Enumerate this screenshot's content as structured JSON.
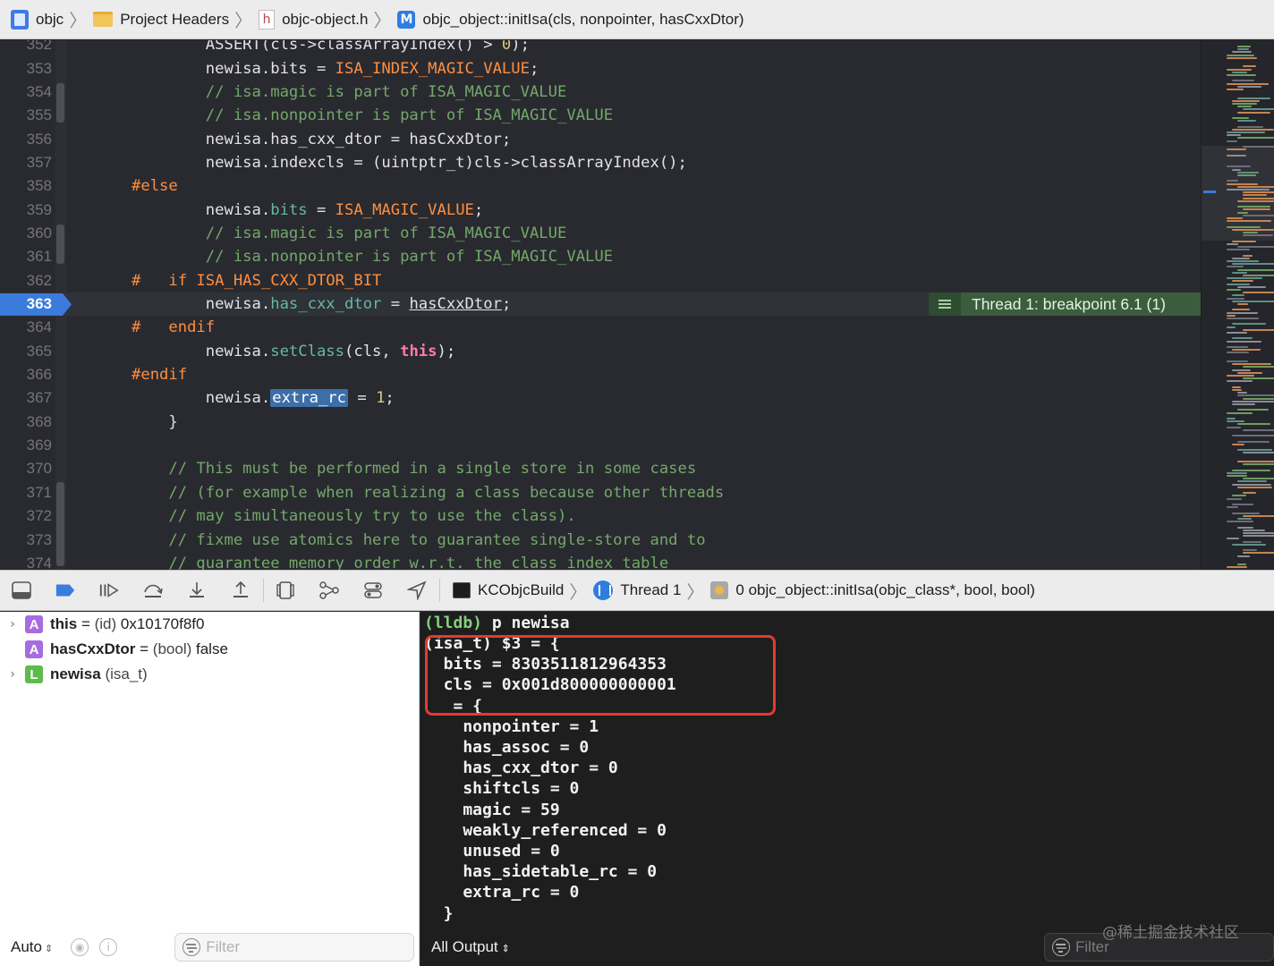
{
  "breadcrumb": {
    "items": [
      {
        "label": "objc",
        "icon": "project-icon"
      },
      {
        "label": "Project Headers",
        "icon": "folder-icon"
      },
      {
        "label": "objc-object.h",
        "icon": "header-file-icon",
        "icon_glyph": "h"
      },
      {
        "label": "objc_object::initIsa(cls, nonpointer, hasCxxDtor)",
        "icon": "method-icon",
        "icon_glyph": "M"
      }
    ]
  },
  "editor": {
    "current_line": "363",
    "breakpoint_banner": "Thread 1: breakpoint 6.1 (1)",
    "lines": [
      {
        "no": "352",
        "text": "        ASSERT(cls->classArrayIndex() > 0);"
      },
      {
        "no": "353",
        "text": "        newisa.bits = ISA_INDEX_MAGIC_VALUE;"
      },
      {
        "no": "354",
        "text": "        // isa.magic is part of ISA_MAGIC_VALUE"
      },
      {
        "no": "355",
        "text": "        // isa.nonpointer is part of ISA_MAGIC_VALUE"
      },
      {
        "no": "356",
        "text": "        newisa.has_cxx_dtor = hasCxxDtor;"
      },
      {
        "no": "357",
        "text": "        newisa.indexcls = (uintptr_t)cls->classArrayIndex();"
      },
      {
        "no": "358",
        "text": "#else"
      },
      {
        "no": "359",
        "text": "        newisa.bits = ISA_MAGIC_VALUE;"
      },
      {
        "no": "360",
        "text": "        // isa.magic is part of ISA_MAGIC_VALUE"
      },
      {
        "no": "361",
        "text": "        // isa.nonpointer is part of ISA_MAGIC_VALUE"
      },
      {
        "no": "362",
        "text": "#   if ISA_HAS_CXX_DTOR_BIT"
      },
      {
        "no": "363",
        "text": "        newisa.has_cxx_dtor = hasCxxDtor;"
      },
      {
        "no": "364",
        "text": "#   endif"
      },
      {
        "no": "365",
        "text": "        newisa.setClass(cls, this);"
      },
      {
        "no": "366",
        "text": "#endif"
      },
      {
        "no": "367",
        "text": "        newisa.extra_rc = 1;"
      },
      {
        "no": "368",
        "text": "    }"
      },
      {
        "no": "369",
        "text": ""
      },
      {
        "no": "370",
        "text": "    // This must be performed in a single store in some cases"
      },
      {
        "no": "371",
        "text": "    // (for example when realizing a class because other threads"
      },
      {
        "no": "372",
        "text": "    // may simultaneously try to use the class)."
      },
      {
        "no": "373",
        "text": "    // fixme use atomics here to guarantee single-store and to"
      },
      {
        "no": "374",
        "text": "    // guarantee memory order w.r.t. the class index table"
      }
    ]
  },
  "debug_bar": {
    "process": "KCObjcBuild",
    "thread": "Thread 1",
    "frame": "0 objc_object::initIsa(objc_class*, bool, bool)"
  },
  "variables": {
    "items": [
      {
        "badge": "A",
        "name": "this",
        "eq": " = ",
        "type": "(id)",
        "value": " 0x10170f8f0",
        "expandable": true
      },
      {
        "badge": "A",
        "name": "hasCxxDtor",
        "eq": " = ",
        "type": "(bool)",
        "value": " false",
        "expandable": false
      },
      {
        "badge": "L",
        "name": "newisa",
        "eq": " ",
        "type": "(isa_t)",
        "value": "",
        "expandable": true
      }
    ],
    "scope": "Auto",
    "filter_placeholder": "Filter"
  },
  "console": {
    "prompt": "(lldb)",
    "command": " p newisa",
    "output": [
      "(isa_t) $3 = {",
      "  bits = 8303511812964353",
      "  cls = 0x001d800000000001",
      "   = {",
      "    nonpointer = 1",
      "    has_assoc = 0",
      "    has_cxx_dtor = 0",
      "    shiftcls = 0",
      "    magic = 59",
      "    weakly_referenced = 0",
      "    unused = 0",
      "    has_sidetable_rc = 0",
      "    extra_rc = 0",
      "  }"
    ],
    "output_mode": "All Output",
    "filter_placeholder": "Filter"
  },
  "watermark": "@稀土掘金技术社区",
  "colors": {
    "editor_bg": "#292a30",
    "breakpoint": "#3a7bdc",
    "banner": "#3b5d3d",
    "highlight_box": "#e23b30",
    "prompt": "#86cf7d"
  }
}
